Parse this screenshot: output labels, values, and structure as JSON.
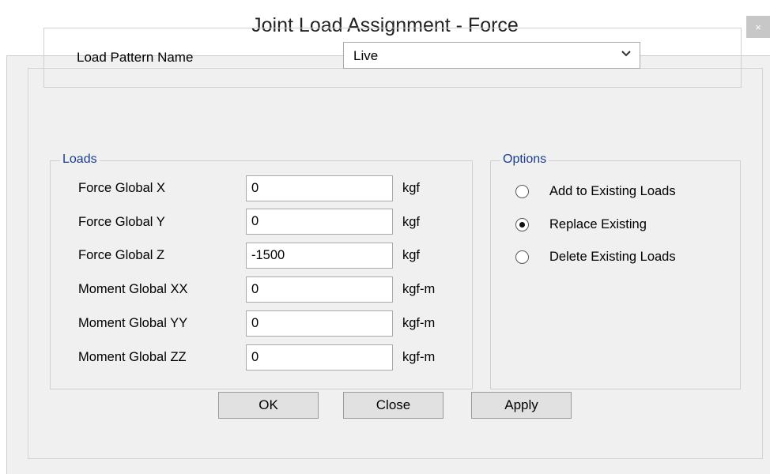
{
  "window": {
    "title": "Joint Load Assignment - Force",
    "close_glyph": "×"
  },
  "load_pattern": {
    "label": "Load Pattern Name",
    "selected": "Live"
  },
  "loads": {
    "title": "Loads",
    "rows": [
      {
        "label": "Force Global X",
        "value": "0",
        "unit": "kgf"
      },
      {
        "label": "Force Global Y",
        "value": "0",
        "unit": "kgf"
      },
      {
        "label": "Force Global Z",
        "value": "-1500",
        "unit": "kgf"
      },
      {
        "label": "Moment Global XX",
        "value": "0",
        "unit": "kgf-m"
      },
      {
        "label": "Moment Global YY",
        "value": "0",
        "unit": "kgf-m"
      },
      {
        "label": "Moment Global ZZ",
        "value": "0",
        "unit": "kgf-m"
      }
    ]
  },
  "options": {
    "title": "Options",
    "items": [
      {
        "label": "Add to Existing Loads",
        "selected": false
      },
      {
        "label": "Replace Existing",
        "selected": true
      },
      {
        "label": "Delete Existing Loads",
        "selected": false
      }
    ]
  },
  "buttons": {
    "ok": "OK",
    "close": "Close",
    "apply": "Apply"
  },
  "colors": {
    "group_title": "#1a3d8f",
    "dialog_bg": "#f0f0f0"
  }
}
